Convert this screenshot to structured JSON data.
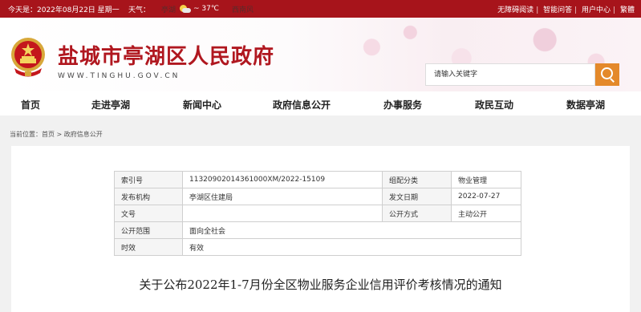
{
  "topbar": {
    "date": "今天是：2022年08月22日 星期一",
    "weather_label": "天气：",
    "city": "亭湖",
    "temperature": "~ 37℃",
    "wind": "西南风",
    "links": [
      "无障碍阅读",
      "智能问答",
      "用户中心",
      "繁體"
    ]
  },
  "header": {
    "title": "盐城市亭湖区人民政府",
    "url": "WWW.TINGHU.GOV.CN",
    "search_placeholder": "请输入关键字",
    "colors": {
      "brand": "#a7141b",
      "title": "#b0171f",
      "search_button": "#e4892a"
    }
  },
  "nav": [
    "首页",
    "走进亭湖",
    "新闻中心",
    "政府信息公开",
    "办事服务",
    "政民互动",
    "数据亭湖"
  ],
  "breadcrumb": "当前位置：首页 > 政府信息公开",
  "meta": {
    "index_label": "索引号",
    "index_value": "11320902014361000XM/2022-15109",
    "category_label": "组配分类",
    "category_value": "物业管理",
    "org_label": "发布机构",
    "org_value": "亭湖区住建局",
    "date_label": "发文日期",
    "date_value": "2022-07-27",
    "docno_label": "文号",
    "docno_value": "",
    "method_label": "公开方式",
    "method_value": "主动公开",
    "scope_label": "公开范围",
    "scope_value": "面向全社会",
    "validity_label": "时效",
    "validity_value": "有效"
  },
  "document": {
    "title": "关于公布2022年1-7月份全区物业服务企业信用评价考核情况的通知"
  }
}
